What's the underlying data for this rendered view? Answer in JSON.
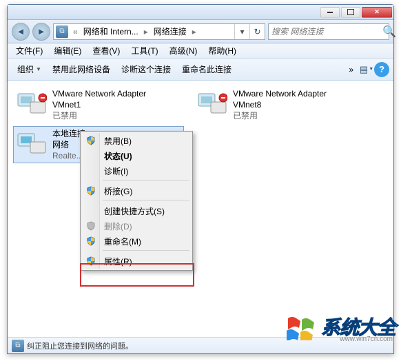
{
  "titlebar": {
    "minimize": "",
    "maximize": "",
    "close": ""
  },
  "address": {
    "back": "◄",
    "forward": "►",
    "crumb1": "网络和 Intern...",
    "crumb2": "网络连接",
    "dropdown": "▾",
    "refresh": "↻"
  },
  "search": {
    "placeholder": "搜索 网络连接",
    "icon": "🔍"
  },
  "menu": {
    "file": "文件(F)",
    "edit": "编辑(E)",
    "view": "查看(V)",
    "tools": "工具(T)",
    "advanced": "高级(N)",
    "help": "帮助(H)"
  },
  "toolbar": {
    "organize": "组织",
    "disable": "禁用此网络设备",
    "diagnose": "诊断这个连接",
    "rename": "重命名此连接",
    "help_icon": "?"
  },
  "connections": [
    {
      "name": "VMware Network Adapter",
      "sub": "VMnet1",
      "status": "已禁用"
    },
    {
      "name": "VMware Network Adapter",
      "sub": "VMnet8",
      "status": "已禁用"
    },
    {
      "name": "本地连接",
      "sub": "网络",
      "status": "Realte..."
    }
  ],
  "context_menu": {
    "disable": "禁用(B)",
    "status": "状态(U)",
    "diagnose": "诊断(I)",
    "bridge": "桥接(G)",
    "shortcut": "创建快捷方式(S)",
    "delete": "删除(D)",
    "rename": "重命名(M)",
    "properties": "属性(R)"
  },
  "statusbar": {
    "text": "纠正阻止您连接到网络的问题。"
  },
  "watermark": {
    "text": "系统大全",
    "url": "www.win7cn.com"
  }
}
